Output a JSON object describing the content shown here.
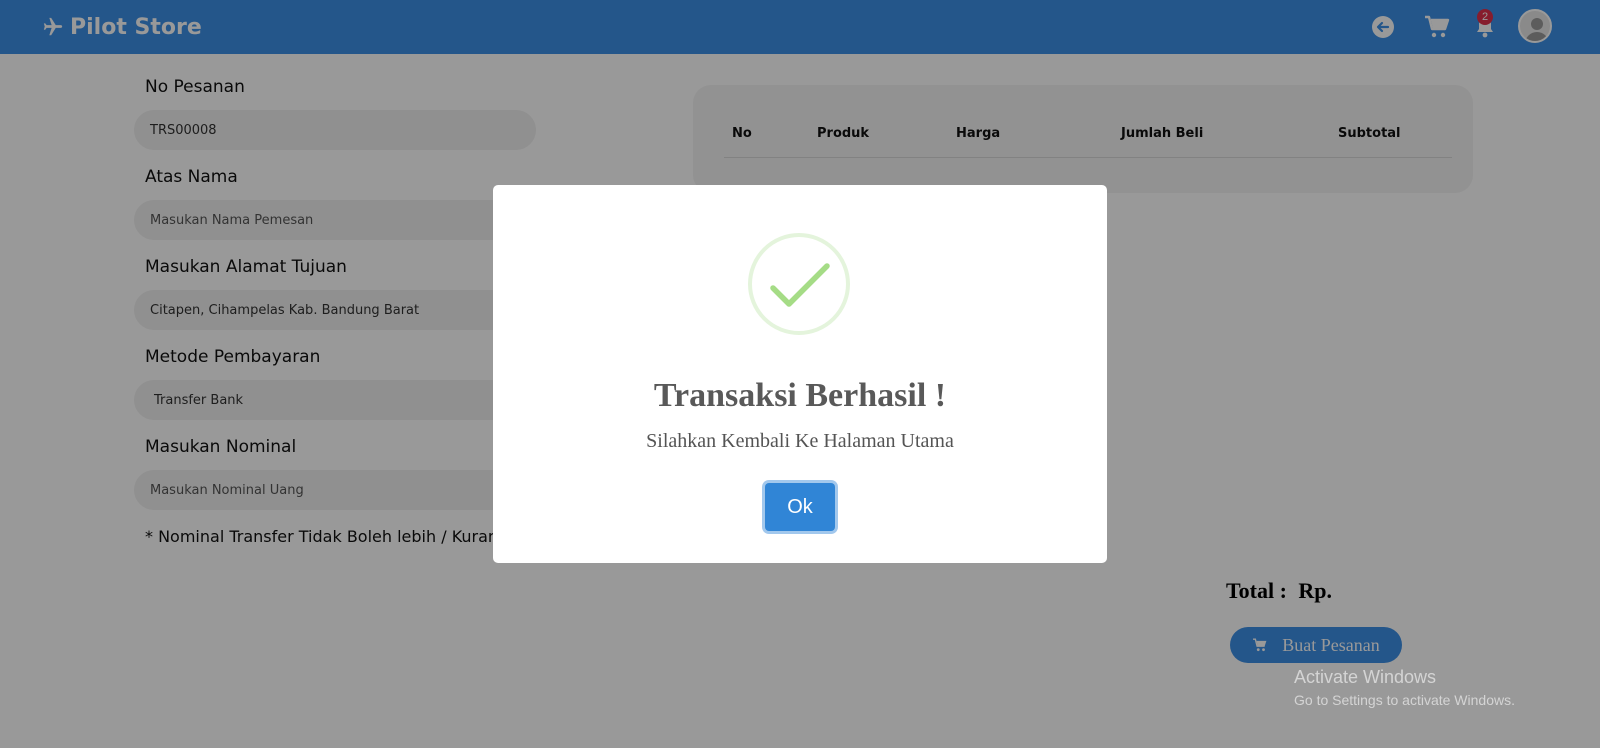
{
  "navbar": {
    "brand": "Pilot Store",
    "notification_count": "2",
    "icons": [
      "airplane-icon",
      "back-arrow-icon",
      "cart-icon",
      "bell-icon",
      "user-avatar-icon"
    ]
  },
  "form": {
    "order_no_label": "No Pesanan",
    "order_no_value": "TRS00008",
    "name_label": "Atas Nama",
    "name_placeholder": "Masukan Nama Pemesan",
    "address_label": "Masukan Alamat Tujuan",
    "address_value": "Citapen, Cihampelas Kab. Bandung Barat",
    "payment_label": "Metode Pembayaran",
    "payment_value": "Transfer Bank",
    "nominal_label": "Masukan Nominal",
    "nominal_placeholder": "Masukan Nominal Uang",
    "note": "* Nominal Transfer Tidak Boleh lebih / Kurang"
  },
  "table": {
    "headers": [
      "No",
      "Produk",
      "Harga",
      "Jumlah Beli",
      "Subtotal"
    ]
  },
  "summary": {
    "total_label": "Total :",
    "total_value": "Rp.",
    "order_button": "Buat Pesanan"
  },
  "watermark": {
    "line1": "Activate Windows",
    "line2": "Go to Settings to activate Windows."
  },
  "modal": {
    "title": "Transaksi Berhasil !",
    "text": "Silahkan Kembali Ke Halaman Utama",
    "ok_button": "Ok"
  },
  "colors": {
    "navbar": "#3d8fe6",
    "success": "#a5dc86",
    "ok_button": "#3085d6",
    "badge": "#e0314b"
  }
}
